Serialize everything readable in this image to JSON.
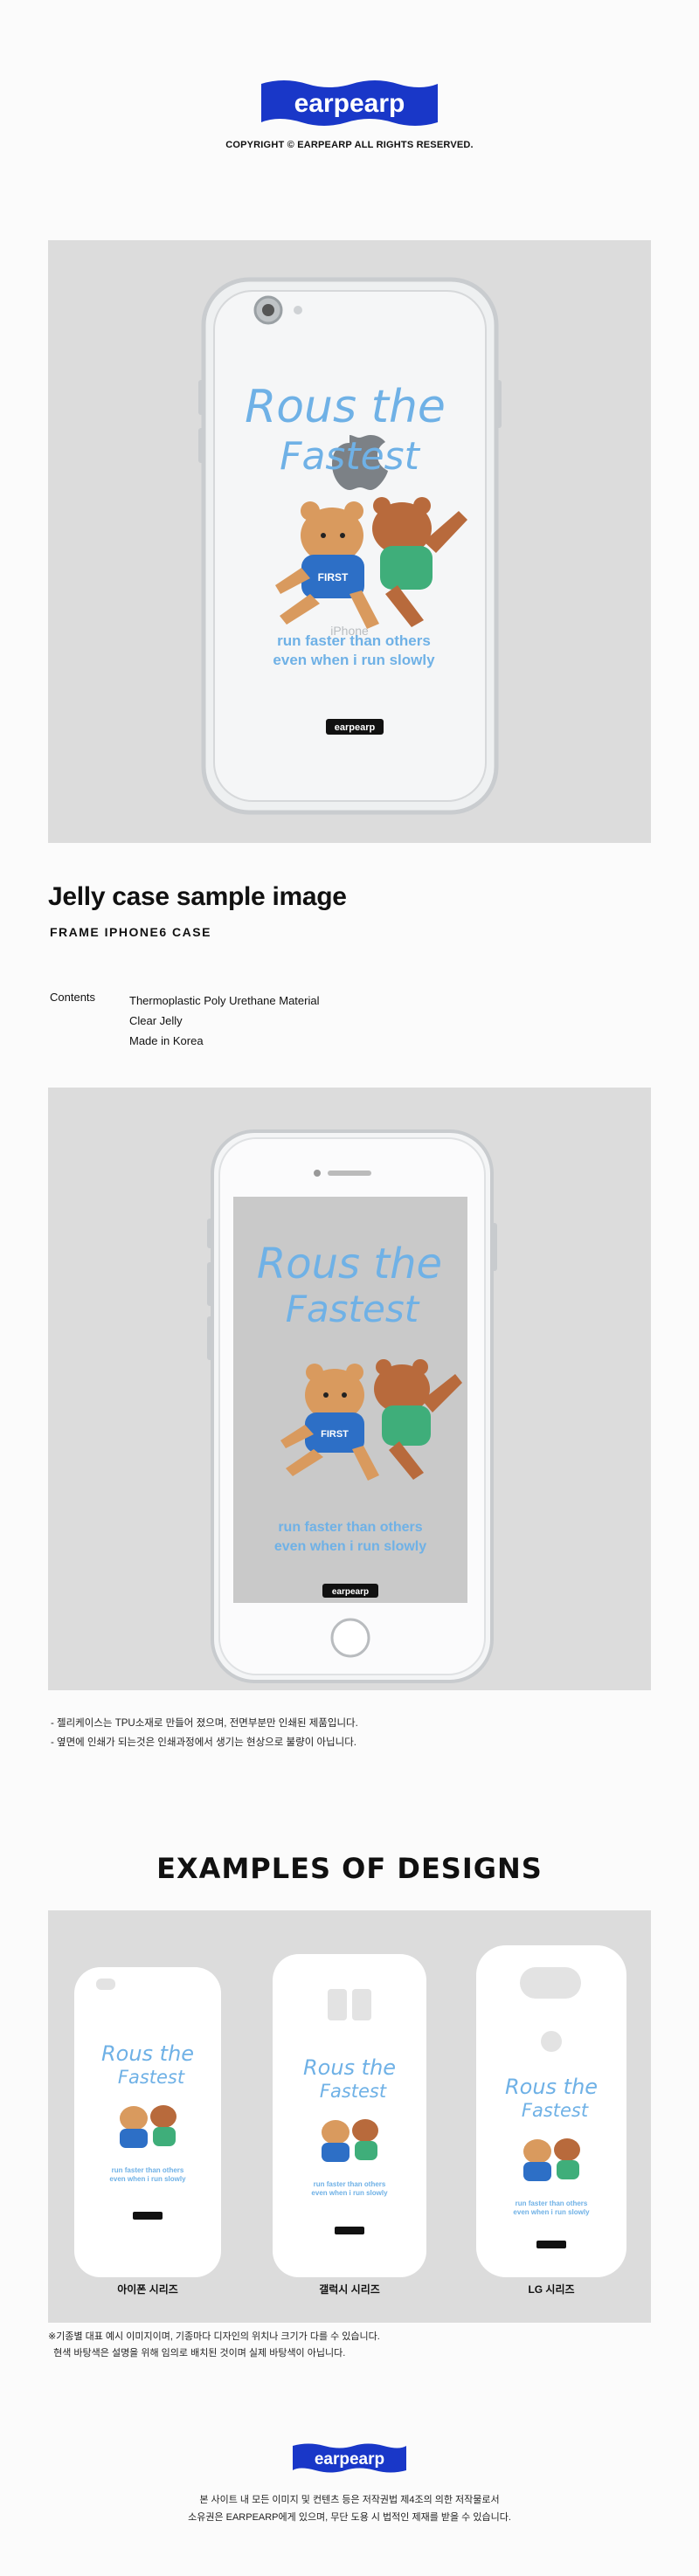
{
  "brand": {
    "logo_text": "earpearp",
    "logo_color": "#1937c8",
    "copyright": "COPYRIGHT © EARPEARP ALL RIGHTS RESERVED."
  },
  "artwork": {
    "headline_line1": "Rous the",
    "headline_line2": "Fastest",
    "shirt_text": "FIRST",
    "tagline_line1": "run faster than others",
    "tagline_line2": "even when i run slowly",
    "phone_model_text": "iPhone",
    "art_color": "#6fb1e6",
    "bear_brown": "#d99a5e",
    "bear_dark": "#b86a3c",
    "shirt_blue": "#2d6fc6",
    "shirt_green": "#3fae7a"
  },
  "product": {
    "title": "Jelly case sample image",
    "subtitle": "FRAME IPHONE6 CASE",
    "contents_label": "Contents",
    "contents": [
      "Thermoplastic Poly Urethane Material",
      "Clear Jelly",
      "Made in Korea"
    ]
  },
  "notes": [
    "- 젤리케이스는 TPU소재로 만들어 졌으며, 전면부분만 인쇄된 제품입니다.",
    "- 옆면에 인쇄가 되는것은 인쇄과정에서 생기는 현상으로 불량이 아닙니다."
  ],
  "examples": {
    "title": "EXAMPLES OF DESIGNS",
    "labels": [
      "아이폰 시리즈",
      "갤럭시 시리즈",
      "LG 시리즈"
    ]
  },
  "bottom_notes": [
    "※기종별 대표 예시 이미지이며, 기종마다 디자인의 위치나 크기가 다를 수 있습니다.",
    "  현색 바탕색은 설명을 위해 임의로 배치된 것이며 실제 바탕색이 아닙니다."
  ],
  "footer": {
    "line1": "본 사이트 내 모든 이미지 및 컨텐츠 등은 저작권법 제4조의 의한 저작물로서",
    "line2": "소유권은 EARPEARP에게 있으며, 무단 도용 시 법적인 제재를 받을 수 있습니다."
  }
}
